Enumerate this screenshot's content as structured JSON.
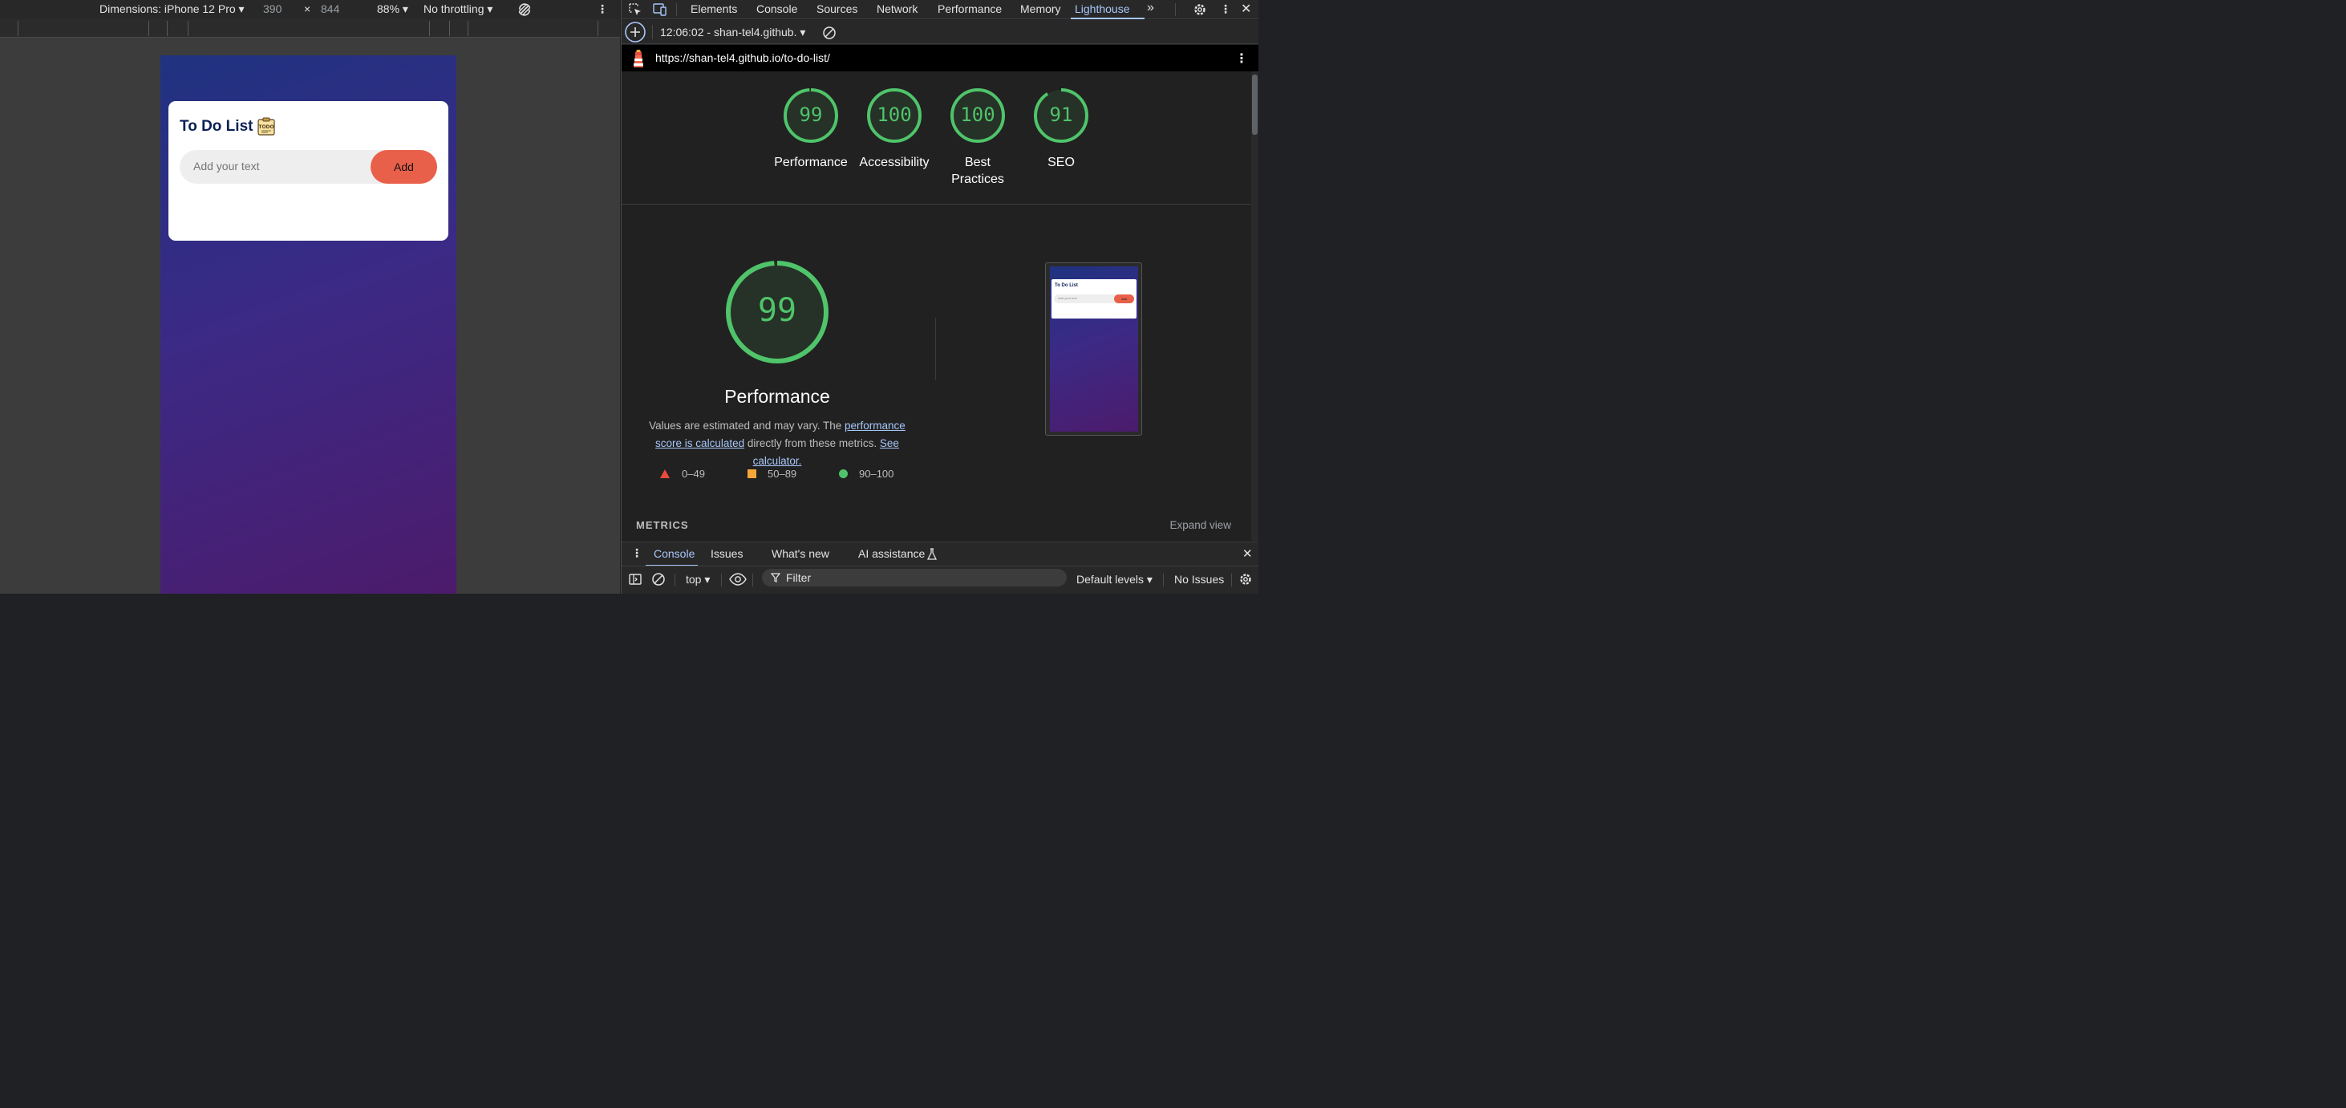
{
  "device_toolbar": {
    "dimensions_label": "Dimensions: iPhone 12 Pro",
    "width": "390",
    "times": "×",
    "height": "844",
    "zoom": "88%",
    "throttling": "No throttling"
  },
  "page": {
    "title": "To Do List",
    "input_placeholder": "Add your text",
    "add_button": "Add"
  },
  "devtools": {
    "tabs": [
      "Elements",
      "Console",
      "Sources",
      "Network",
      "Performance",
      "Memory",
      "Lighthouse"
    ],
    "active_tab": "Lighthouse",
    "report_selector": "12:06:02 - shan-tel4.github.",
    "url": "https://shan-tel4.github.io/to-do-list/"
  },
  "scores": [
    {
      "label": "Performance",
      "value": 99
    },
    {
      "label": "Accessibility",
      "value": 100
    },
    {
      "label": "Best Practices",
      "value": 100
    },
    {
      "label": "SEO",
      "value": 91
    }
  ],
  "performance": {
    "score": "99",
    "title": "Performance",
    "desc_pre": "Values are estimated and may vary. The ",
    "desc_link1": "performance score is calculated",
    "desc_mid": " directly from these metrics. ",
    "desc_link2": "See calculator."
  },
  "legend": {
    "fail": "0–49",
    "average": "50–89",
    "pass": "90–100"
  },
  "metrics": {
    "label": "METRICS",
    "expand": "Expand view"
  },
  "drawer": {
    "tabs": [
      "Console",
      "Issues",
      "What's new",
      "AI assistance"
    ],
    "active": "Console"
  },
  "console_bar": {
    "context": "top",
    "filter_placeholder": "Filter",
    "levels": "Default levels",
    "issues": "No Issues"
  },
  "colors": {
    "pass": "#4fc46a",
    "average": "#f4a63b",
    "fail": "#eb4b3d",
    "accent": "#a8c7fa",
    "add_button": "#e9604a"
  }
}
